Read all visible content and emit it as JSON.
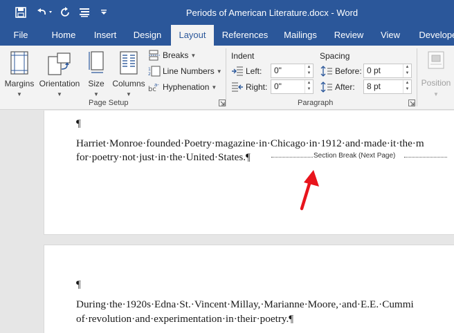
{
  "window": {
    "title": "Periods of American Literature.docx  -  Word"
  },
  "tabs": [
    {
      "label": "File"
    },
    {
      "label": "Home"
    },
    {
      "label": "Insert"
    },
    {
      "label": "Design"
    },
    {
      "label": "Layout"
    },
    {
      "label": "References"
    },
    {
      "label": "Mailings"
    },
    {
      "label": "Review"
    },
    {
      "label": "View"
    },
    {
      "label": "Developer"
    }
  ],
  "active_tab": "Layout",
  "ribbon": {
    "page_setup": {
      "group_label": "Page Setup",
      "margins": "Margins",
      "orientation": "Orientation",
      "size": "Size",
      "columns": "Columns",
      "breaks": "Breaks",
      "line_numbers": "Line Numbers",
      "hyphenation": "Hyphenation"
    },
    "paragraph": {
      "group_label": "Paragraph",
      "indent_label": "Indent",
      "spacing_label": "Spacing",
      "left_label": "Left:",
      "right_label": "Right:",
      "before_label": "Before:",
      "after_label": "After:",
      "left_value": "0\"",
      "right_value": "0\"",
      "before_value": "0 pt",
      "after_value": "8 pt"
    },
    "arrange": {
      "position": "Position"
    }
  },
  "document": {
    "page1_mark": "¶",
    "page1_line1": "Harriet·Monroe·founded·Poetry·magazine·in·Chicago·in·1912·and·made·it·the·m",
    "page1_line2": "for·poetry·not·just·in·the·United·States.¶",
    "section_break": "Section Break (Next Page)",
    "page2_mark": "¶",
    "page2_line1": "During·the·1920s·Edna·St.·Vincent·Millay,·Marianne·Moore,·and·E.E.·Cummi",
    "page2_line2": "of·revolution·and·experimentation·in·their·poetry.¶"
  },
  "colors": {
    "brand": "#2b579a",
    "annotation_arrow": "#e8141c"
  }
}
